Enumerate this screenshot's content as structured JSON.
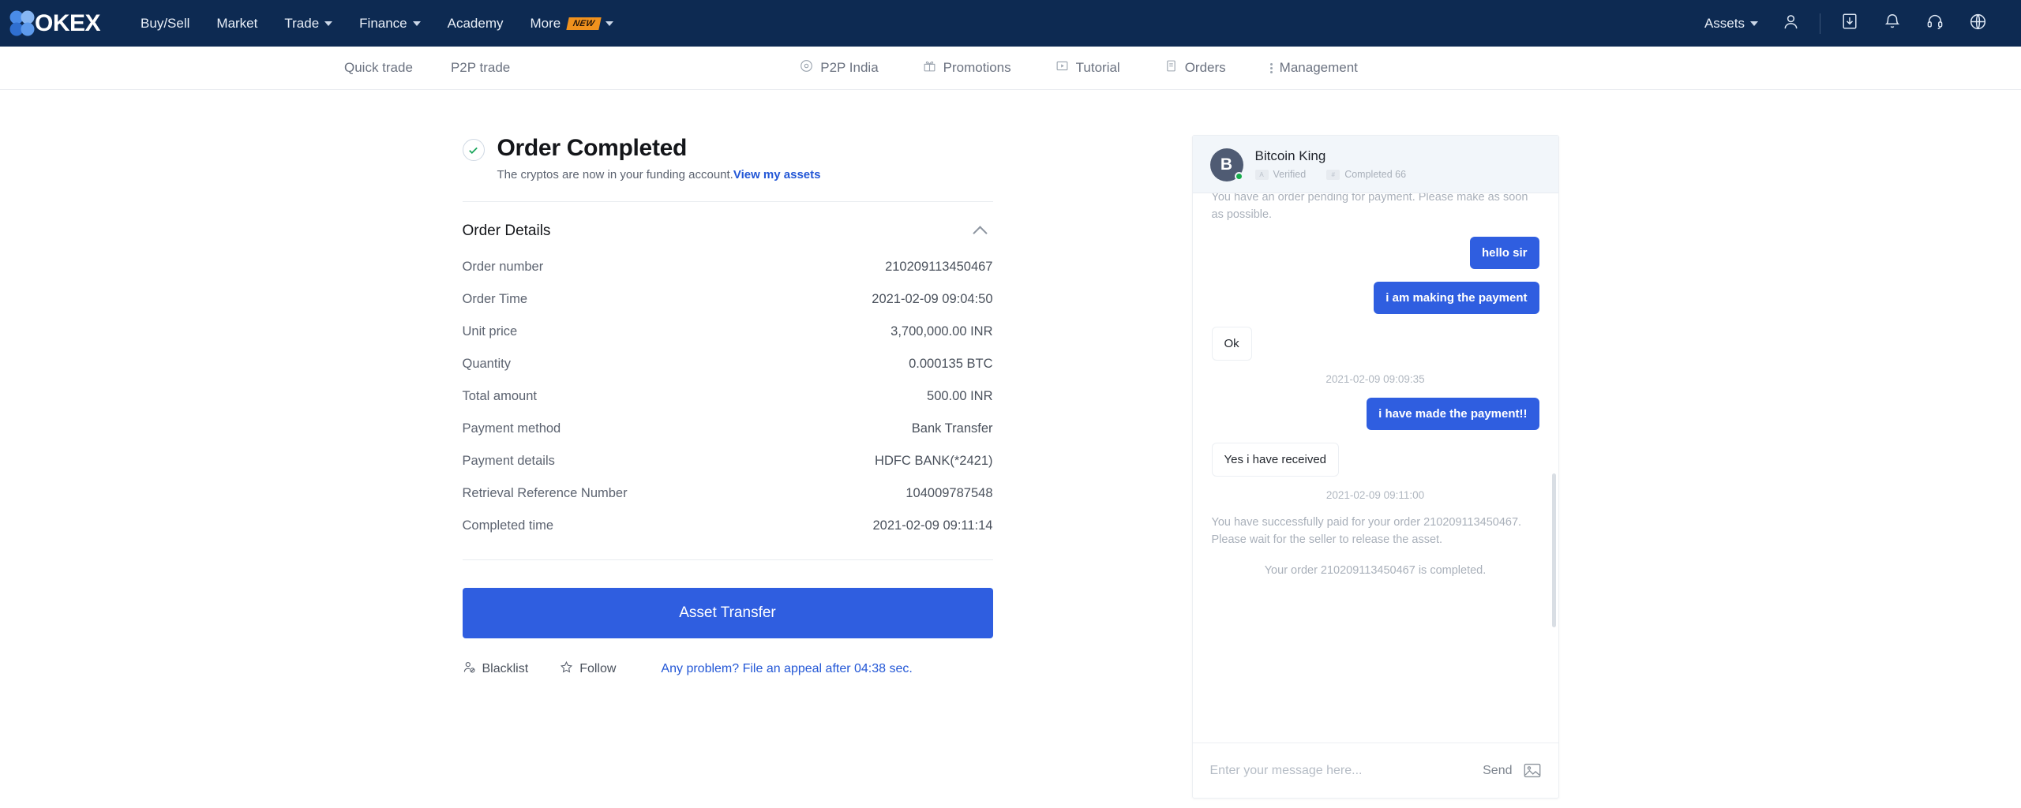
{
  "topnav": {
    "brand": "OKEX",
    "links": [
      {
        "label": "Buy/Sell",
        "caret": false,
        "badge": null
      },
      {
        "label": "Market",
        "caret": false,
        "badge": null
      },
      {
        "label": "Trade",
        "caret": true,
        "badge": null
      },
      {
        "label": "Finance",
        "caret": true,
        "badge": null
      },
      {
        "label": "Academy",
        "caret": false,
        "badge": null
      },
      {
        "label": "More",
        "caret": true,
        "badge": "NEW"
      }
    ],
    "assets_label": "Assets",
    "icons": [
      "user-icon",
      "download-icon",
      "bell-icon",
      "headset-icon",
      "globe-icon"
    ],
    "bg_color": "#0d2a52",
    "badge_color": "#f0921e"
  },
  "subnav": {
    "left_items": [
      {
        "label": "Quick trade",
        "icon": null
      },
      {
        "label": "P2P trade",
        "icon": null
      }
    ],
    "right_items": [
      {
        "label": "P2P India",
        "icon": "target-icon"
      },
      {
        "label": "Promotions",
        "icon": "gift-icon"
      },
      {
        "label": "Tutorial",
        "icon": "play-box-icon"
      },
      {
        "label": "Orders",
        "icon": "document-icon"
      },
      {
        "label": "Management",
        "icon": "kebab-menu-icon"
      }
    ]
  },
  "order": {
    "status_title": "Order Completed",
    "status_icon": "check-circle-icon",
    "subtitle": "The cryptos are now in your funding account.",
    "subtitle_link": "View my assets",
    "details_title": "Order Details",
    "rows": [
      {
        "label": "Order number",
        "value": "210209113450467"
      },
      {
        "label": "Order Time",
        "value": "2021-02-09 09:04:50"
      },
      {
        "label": "Unit price",
        "value": "3,700,000.00 INR"
      },
      {
        "label": "Quantity",
        "value": "0.000135 BTC"
      },
      {
        "label": "Total amount",
        "value": "500.00 INR"
      },
      {
        "label": "Payment method",
        "value": "Bank Transfer"
      },
      {
        "label": "Payment details",
        "value": "HDFC BANK(*2421)"
      },
      {
        "label": "Retrieval Reference Number",
        "value": "104009787548"
      },
      {
        "label": "Completed time",
        "value": "2021-02-09 09:11:14"
      }
    ],
    "primary_button": "Asset Transfer",
    "blacklist_label": "Blacklist",
    "follow_label": "Follow",
    "appeal_label": "Any problem? File an appeal after 04:38 sec.",
    "accent_color": "#2f5ee0",
    "link_color": "#2357d6"
  },
  "chat": {
    "peer_name": "Bitcoin King",
    "avatar_initial": "B",
    "verified_label": "Verified",
    "completed_label": "Completed 66",
    "messages": [
      {
        "type": "system",
        "text": "You have an order pending for payment. Please make as soon as possible.",
        "align": "left"
      },
      {
        "type": "me",
        "text": "hello sir"
      },
      {
        "type": "me",
        "text": "i am making the payment"
      },
      {
        "type": "them",
        "text": "Ok"
      },
      {
        "type": "timestamp",
        "text": "2021-02-09 09:09:35"
      },
      {
        "type": "me",
        "text": "i have made the payment!!"
      },
      {
        "type": "them",
        "text": "Yes i have received"
      },
      {
        "type": "timestamp",
        "text": "2021-02-09 09:11:00"
      },
      {
        "type": "system",
        "text": "You have successfully paid for your order 210209113450467. Please wait for the seller to release the asset.",
        "align": "left"
      },
      {
        "type": "system",
        "text": "Your order 210209113450467 is completed.",
        "align": "center"
      }
    ],
    "input_placeholder": "Enter your message here...",
    "input_value": "",
    "send_label": "Send",
    "image_icon": "image-icon"
  }
}
